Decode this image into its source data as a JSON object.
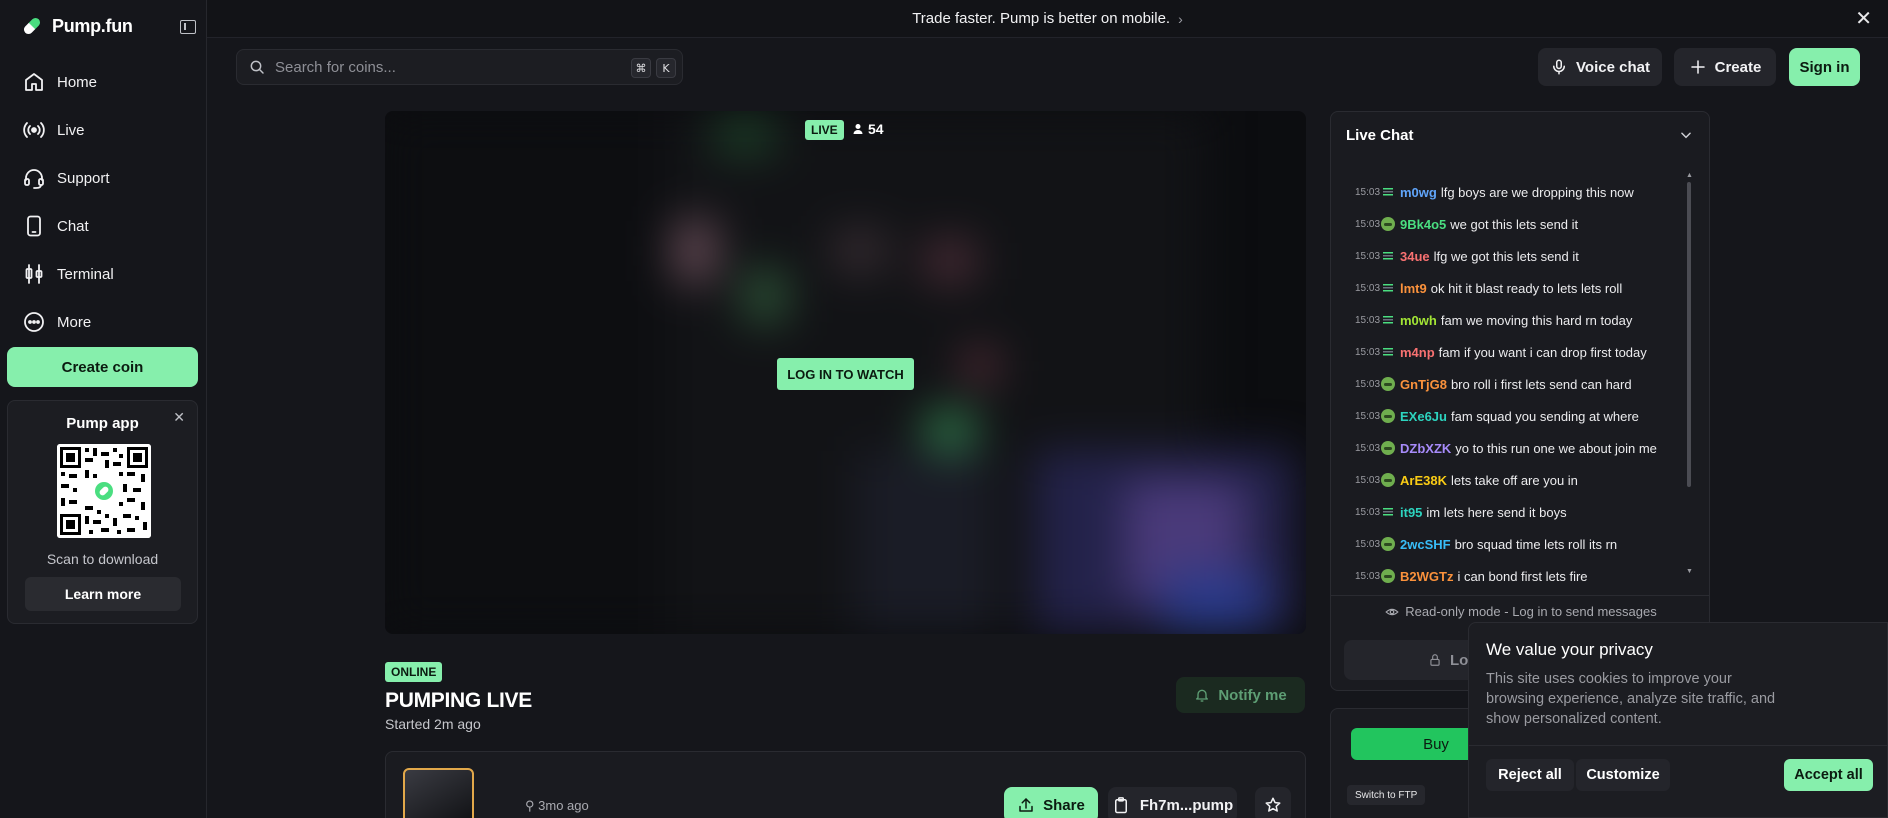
{
  "brand": {
    "name": "Pump.fun"
  },
  "sidebar": {
    "items": [
      {
        "label": "Home",
        "icon": "home-icon"
      },
      {
        "label": "Live",
        "icon": "broadcast-icon"
      },
      {
        "label": "Support",
        "icon": "headset-icon"
      },
      {
        "label": "Chat",
        "icon": "phone-icon"
      },
      {
        "label": "Terminal",
        "icon": "candlestick-icon"
      },
      {
        "label": "More",
        "icon": "more-circle-icon"
      }
    ],
    "create_coin": "Create coin",
    "pump_app": {
      "title": "Pump app",
      "scan_text": "Scan to download",
      "learn_more": "Learn more"
    }
  },
  "banner": {
    "text": "Trade faster. Pump is better on mobile."
  },
  "search": {
    "placeholder": "Search for coins...",
    "kbd_1": "⌘",
    "kbd_2": "K"
  },
  "header": {
    "voice_chat": "Voice chat",
    "create": "Create",
    "sign_in": "Sign in"
  },
  "video": {
    "live_label": "LIVE",
    "viewers": "54",
    "login_to_watch": "LOG IN TO WATCH"
  },
  "stream": {
    "status": "ONLINE",
    "title": "PUMPING LIVE",
    "started": "Started 2m ago",
    "notify": "Notify me",
    "coin_age": "3mo ago",
    "share": "Share",
    "contract": "Fh7m...pump"
  },
  "chat": {
    "title": "Live Chat",
    "readonly": "Read-only mode - Log in to send messages",
    "login": "Lo",
    "messages": [
      {
        "time": "15:03",
        "user": "m0wg",
        "text": "lfg boys are we dropping this now",
        "color": "#60a5fa",
        "avatar": "chart"
      },
      {
        "time": "15:03",
        "user": "9Bk4o5",
        "text": "we got this lets send it",
        "color": "#4ade80",
        "avatar": "pepe"
      },
      {
        "time": "15:03",
        "user": "34ue",
        "text": "lfg we got this lets send it",
        "color": "#f87171",
        "avatar": "chart"
      },
      {
        "time": "15:03",
        "user": "lmt9",
        "text": "ok hit it blast ready to lets lets roll",
        "color": "#fb923c",
        "avatar": "chart"
      },
      {
        "time": "15:03",
        "user": "m0wh",
        "text": "fam we moving this hard rn today",
        "color": "#a3e635",
        "avatar": "chart"
      },
      {
        "time": "15:03",
        "user": "m4np",
        "text": "fam if you want i can drop first today",
        "color": "#f87171",
        "avatar": "chart"
      },
      {
        "time": "15:03",
        "user": "GnTjG8",
        "text": "bro roll i first lets send can hard",
        "color": "#fb923c",
        "avatar": "pepe"
      },
      {
        "time": "15:03",
        "user": "EXe6Ju",
        "text": "fam squad you sending at where",
        "color": "#2dd4bf",
        "avatar": "pepe"
      },
      {
        "time": "15:03",
        "user": "DZbXZK",
        "text": "yo to this run one we about join me",
        "color": "#a78bfa",
        "avatar": "pepe"
      },
      {
        "time": "15:03",
        "user": "ArE38K",
        "text": "lets take off are you in",
        "color": "#facc15",
        "avatar": "pepe"
      },
      {
        "time": "15:03",
        "user": "it95",
        "text": "im lets here send it boys",
        "color": "#2dd4bf",
        "avatar": "chart"
      },
      {
        "time": "15:03",
        "user": "2wcSHF",
        "text": "bro squad time lets roll its rn",
        "color": "#38bdf8",
        "avatar": "pepe"
      },
      {
        "time": "15:03",
        "user": "B2WGTz",
        "text": "i can bond first lets fire",
        "color": "#fb923c",
        "avatar": "pepe"
      }
    ]
  },
  "trade": {
    "buy": "Buy",
    "switch": "Switch to FTP"
  },
  "cookie": {
    "title": "We value your privacy",
    "body": "This site uses cookies to improve your browsing experience, analyze site traffic, and show personalized content.",
    "reject": "Reject all",
    "customize": "Customize",
    "accept": "Accept all"
  },
  "colors": {
    "accent": "#86efac",
    "background": "#15161b",
    "panel": "#1a1b20"
  }
}
